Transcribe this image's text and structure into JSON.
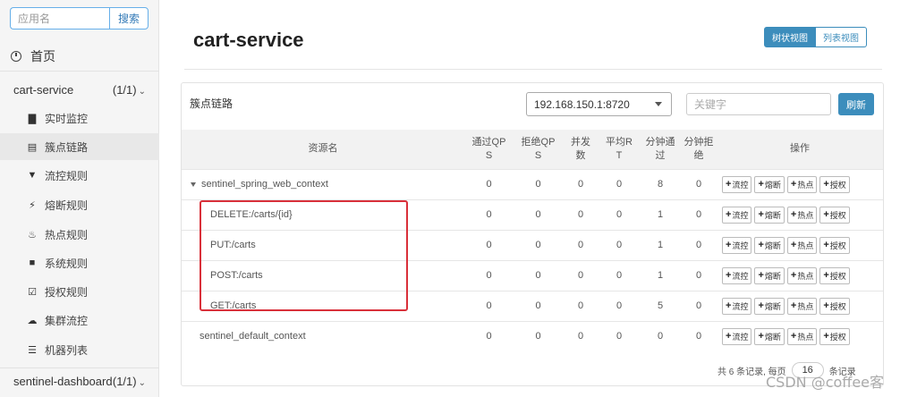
{
  "sidebar": {
    "search": {
      "placeholder": "应用名",
      "button": "搜索"
    },
    "home": "首页",
    "groups": [
      {
        "name": "cart-service",
        "count": "(1/1)"
      },
      {
        "name": "sentinel-dashboard",
        "count": "(1/1)"
      }
    ],
    "items": [
      {
        "label": "实时监控",
        "icon": "bar-chart-icon"
      },
      {
        "label": "簇点链路",
        "icon": "list-icon"
      },
      {
        "label": "流控规则",
        "icon": "filter-icon"
      },
      {
        "label": "熔断规则",
        "icon": "flash-icon"
      },
      {
        "label": "热点规则",
        "icon": "fire-icon"
      },
      {
        "label": "系统规则",
        "icon": "lock-icon"
      },
      {
        "label": "授权规则",
        "icon": "check-icon"
      },
      {
        "label": "集群流控",
        "icon": "cloud-icon"
      },
      {
        "label": "机器列表",
        "icon": "th-list-icon"
      }
    ]
  },
  "main": {
    "title": "cart-service",
    "view_toggle": {
      "tree": "树状视图",
      "list": "列表视图"
    },
    "panel_label": "簇点链路",
    "machine": "192.168.150.1:8720",
    "keyword_placeholder": "关键字",
    "refresh": "刷新",
    "columns": {
      "name": "资源名",
      "pass_qps": [
        "通过QP",
        "S"
      ],
      "block_qps": [
        "拒绝QP",
        "S"
      ],
      "concurrency": [
        "并发",
        "数"
      ],
      "avg_rt": [
        "平均R",
        "T"
      ],
      "minute_pass": [
        "分钟通",
        "过"
      ],
      "minute_block": [
        "分钟拒",
        "绝"
      ],
      "ops": "操作"
    },
    "rows": [
      {
        "name": "sentinel_spring_web_context",
        "values": [
          "0",
          "0",
          "0",
          "0",
          "8",
          "0"
        ]
      },
      {
        "name": "DELETE:/carts/{id}",
        "values": [
          "0",
          "0",
          "0",
          "0",
          "1",
          "0"
        ]
      },
      {
        "name": "PUT:/carts",
        "values": [
          "0",
          "0",
          "0",
          "0",
          "1",
          "0"
        ]
      },
      {
        "name": "POST:/carts",
        "values": [
          "0",
          "0",
          "0",
          "0",
          "1",
          "0"
        ]
      },
      {
        "name": "GET:/carts",
        "values": [
          "0",
          "0",
          "0",
          "0",
          "5",
          "0"
        ]
      },
      {
        "name": "sentinel_default_context",
        "values": [
          "0",
          "0",
          "0",
          "0",
          "0",
          "0"
        ]
      }
    ],
    "op_buttons": [
      "流控",
      "熔断",
      "热点",
      "授权"
    ],
    "pager": {
      "prefix": "共 6 条记录, 每页",
      "size": "16",
      "suffix": "条记录"
    }
  },
  "watermark": "CSDN @coffee客"
}
